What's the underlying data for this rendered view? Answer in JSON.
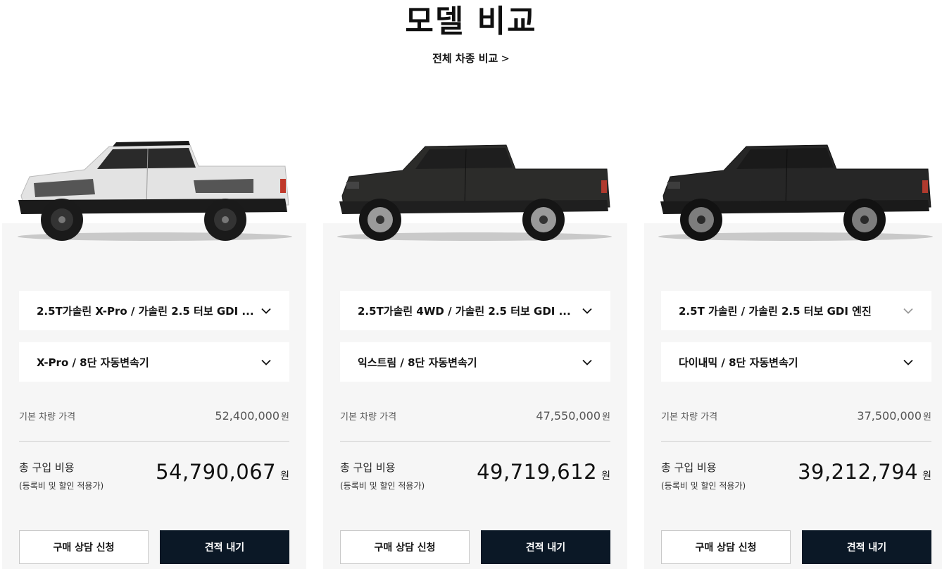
{
  "header": {
    "title": "모델 비교",
    "compare_link": "전체 차종 비교",
    "compare_link_chevron": ">"
  },
  "colors": {
    "card_bg": "#f6f6f6",
    "quote_button_bg": "#0b1826",
    "truck_1_body": "#e3e3e3",
    "truck_2_body": "#2c2c2a",
    "truck_3_body": "#262626"
  },
  "cards": [
    {
      "engine_select": "2.5T가솔린 X-Pro / 가솔린 2.5 터보 GDI ...",
      "trim_select": "X-Pro / 8단 자동변속기",
      "base_price_label": "기본 차량 가격",
      "base_price": "52,400,000",
      "base_price_unit": "원",
      "total_label": "총 구입 비용",
      "total_sub": "(등록비 및 할인 적용가)",
      "total_price": "54,790,067",
      "total_unit": "원",
      "consult_button": "구매 상담 신청",
      "quote_button": "견적 내기"
    },
    {
      "engine_select": "2.5T가솔린 4WD / 가솔린 2.5 터보 GDI ...",
      "trim_select": "익스트림 / 8단 자동변속기",
      "base_price_label": "기본 차량 가격",
      "base_price": "47,550,000",
      "base_price_unit": "원",
      "total_label": "총 구입 비용",
      "total_sub": "(등록비 및 할인 적용가)",
      "total_price": "49,719,612",
      "total_unit": "원",
      "consult_button": "구매 상담 신청",
      "quote_button": "견적 내기"
    },
    {
      "engine_select": "2.5T 가솔린 / 가솔린 2.5 터보 GDI 엔진",
      "trim_select": "다이내믹 / 8단 자동변속기",
      "base_price_label": "기본 차량 가격",
      "base_price": "37,500,000",
      "base_price_unit": "원",
      "total_label": "총 구입 비용",
      "total_sub": "(등록비 및 할인 적용가)",
      "total_price": "39,212,794",
      "total_unit": "원",
      "consult_button": "구매 상담 신청",
      "quote_button": "견적 내기"
    }
  ]
}
